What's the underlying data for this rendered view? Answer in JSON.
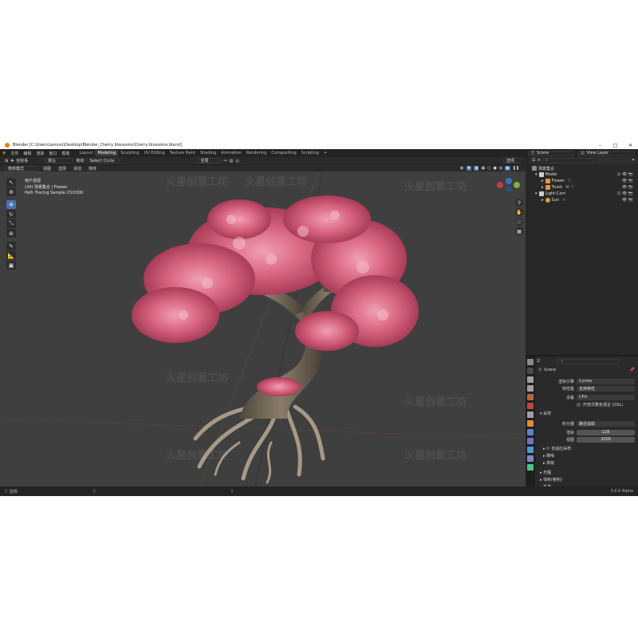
{
  "window": {
    "title": "Blender [C:\\Users\\Lenovo\\Desktop\\Blender_Cherry blossoms\\Cherry blossoms.blend]",
    "controls": [
      "–",
      "□",
      "✕"
    ]
  },
  "menu": [
    "文件",
    "编辑",
    "渲染",
    "窗口",
    "帮助"
  ],
  "workspaces": [
    "Layout",
    "Modeling",
    "Sculpting",
    "UV Editing",
    "Texture Paint",
    "Shading",
    "Animation",
    "Rendering",
    "Compositing",
    "Scripting",
    "+"
  ],
  "active_workspace": "Modeling",
  "scene_field": "Scene",
  "view_layer_field": "View Layer",
  "viewport_header": {
    "transform_label": "坐标系",
    "orientation": "默认",
    "drag_label": "拖动",
    "select_mode": "Select Circle",
    "pivot": "全局",
    "options_label": "选项"
  },
  "viewport_header2": [
    "物体模式",
    "视图",
    "选择",
    "添加",
    "物体"
  ],
  "viewport_overlay": {
    "view_name": "用户透视",
    "collection": "(34) 场景集合 | Flower",
    "render_status": "Path Tracing Sample 23/2000"
  },
  "nav_buttons": [
    "⚲",
    "✋",
    "🎥",
    "▦"
  ],
  "gizmo_axes": [
    "X",
    "Y",
    "Z"
  ],
  "watermark": "火星创意工坊",
  "outliner": {
    "search_placeholder": "",
    "items": [
      {
        "label": "场景集合",
        "level": 0,
        "type": "collection"
      },
      {
        "label": "Model",
        "level": 1,
        "type": "collection"
      },
      {
        "label": "Flower",
        "level": 2,
        "type": "object"
      },
      {
        "label": "Trunk",
        "level": 2,
        "type": "object"
      },
      {
        "label": "Light-Cam",
        "level": 1,
        "type": "collection"
      },
      {
        "label": "Sun",
        "level": 2,
        "type": "light"
      }
    ]
  },
  "properties": {
    "header": "Scene",
    "render_engine_label": "渲染引擎",
    "render_engine": "Cycles",
    "feature_set_label": "特性集",
    "feature_set": "支持特性",
    "device_label": "设备",
    "device": "CPU",
    "osl_label": "开放式着色语言 (OSL)",
    "sampling_label": "采样",
    "integrator_label": "积分器",
    "integrator": "路径追踪",
    "render_label": "渲染",
    "render_samples": "128",
    "viewport_label": "视图",
    "viewport_samples": "3200",
    "subsections": [
      "自适应采样",
      "降噪",
      "高级"
    ],
    "bottom_sections": [
      "光程",
      "体积(卷积)",
      "毛发"
    ]
  },
  "status": {
    "left": "选择",
    "version": "3.0.0 Alpha"
  },
  "colors": {
    "accent": "#4772b3",
    "blossom": "#d9607f",
    "trunk": "#6f6455",
    "viewport_bg": "#3f3f3f"
  }
}
